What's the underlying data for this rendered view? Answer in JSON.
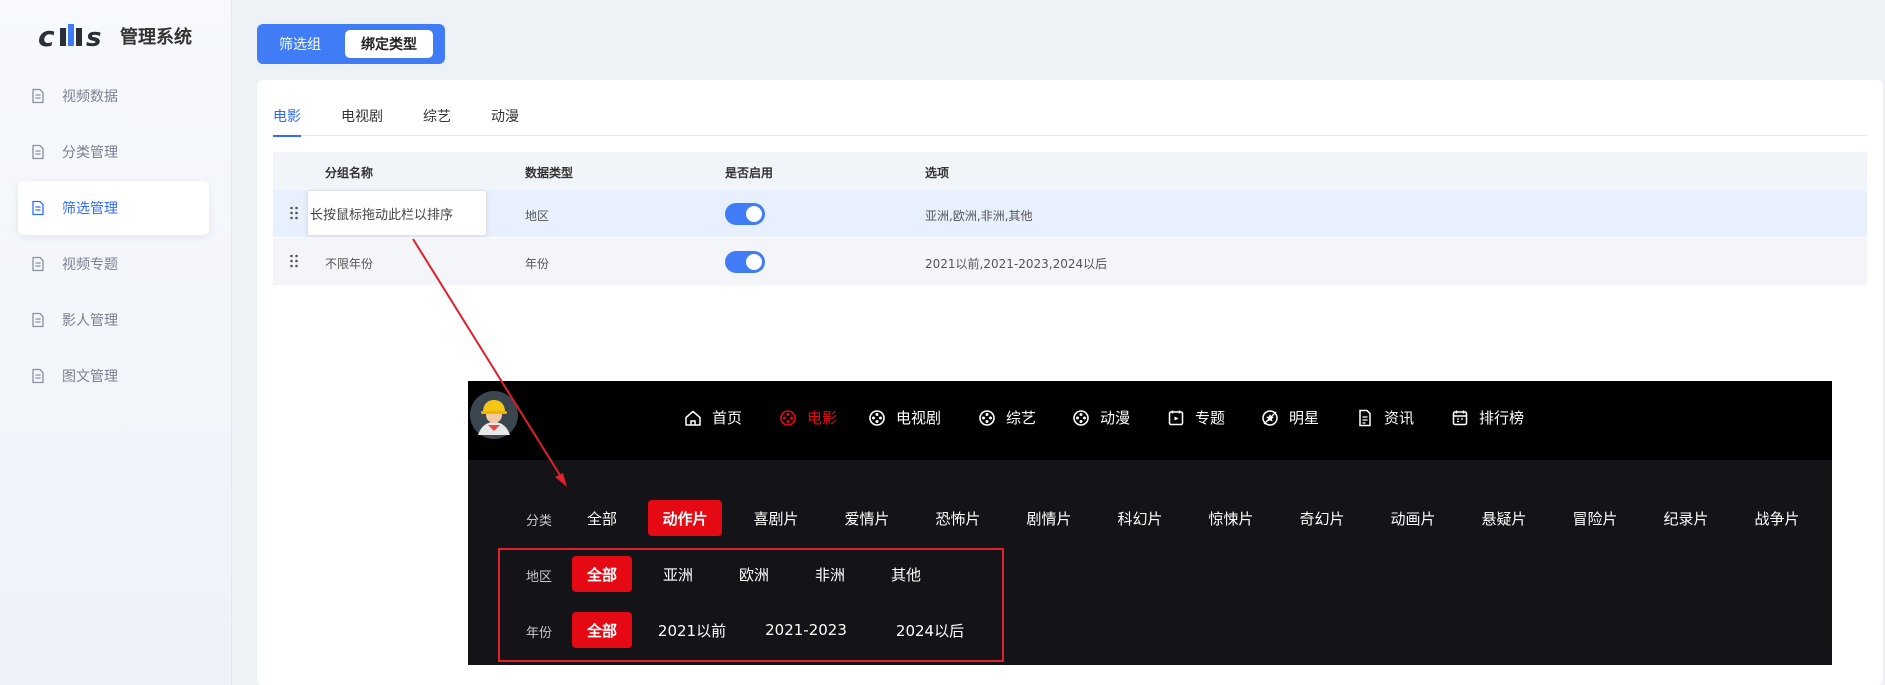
{
  "app": {
    "brand_title": "管理系统"
  },
  "sidebar": {
    "items": [
      {
        "label": "视频数据",
        "icon": "document-icon",
        "active": false
      },
      {
        "label": "分类管理",
        "icon": "document-icon",
        "active": false
      },
      {
        "label": "筛选管理",
        "icon": "document-icon",
        "active": true
      },
      {
        "label": "视频专题",
        "icon": "document-icon",
        "active": false
      },
      {
        "label": "影人管理",
        "icon": "document-icon",
        "active": false
      },
      {
        "label": "图文管理",
        "icon": "document-icon",
        "active": false
      }
    ]
  },
  "segmented": {
    "filter_group": "筛选组",
    "bind_type": "绑定类型",
    "selected": "绑定类型"
  },
  "tabs": [
    {
      "label": "电影",
      "active": true
    },
    {
      "label": "电视剧",
      "active": false
    },
    {
      "label": "综艺",
      "active": false
    },
    {
      "label": "动漫",
      "active": false
    }
  ],
  "table": {
    "headers": {
      "name": "分组名称",
      "data_type": "数据类型",
      "enabled": "是否启用",
      "options": "选项"
    },
    "rows": [
      {
        "name": "",
        "data_type": "地区",
        "enabled": true,
        "options": "亚洲,欧洲,非洲,其他"
      },
      {
        "name": "不限年份",
        "data_type": "年份",
        "enabled": true,
        "options": "2021以前,2021-2023,2024以后"
      }
    ],
    "drag_tooltip": "长按鼠标拖动此栏以排序"
  },
  "preview": {
    "nav": [
      {
        "label": "首页",
        "icon": "home-icon",
        "active": false
      },
      {
        "label": "电影",
        "icon": "film-reel-icon",
        "active": true
      },
      {
        "label": "电视剧",
        "icon": "film-reel-icon",
        "active": false
      },
      {
        "label": "综艺",
        "icon": "film-reel-icon",
        "active": false
      },
      {
        "label": "动漫",
        "icon": "film-reel-icon",
        "active": false
      },
      {
        "label": "专题",
        "icon": "calendar-play-icon",
        "active": false
      },
      {
        "label": "明星",
        "icon": "star-badge-icon",
        "active": false
      },
      {
        "label": "资讯",
        "icon": "news-document-icon",
        "active": false
      },
      {
        "label": "排行榜",
        "icon": "calendar-icon",
        "active": false
      }
    ],
    "filters": {
      "category": {
        "label": "分类",
        "options": [
          "全部",
          "动作片",
          "喜剧片",
          "爱情片",
          "恐怖片",
          "剧情片",
          "科幻片",
          "惊悚片",
          "奇幻片",
          "动画片",
          "悬疑片",
          "冒险片",
          "纪录片",
          "战争片"
        ],
        "selected": "动作片"
      },
      "region": {
        "label": "地区",
        "options": [
          "全部",
          "亚洲",
          "欧洲",
          "非洲",
          "其他"
        ],
        "selected": "全部"
      },
      "year": {
        "label": "年份",
        "options": [
          "全部",
          "2021以前",
          "2021-2023",
          "2024以后"
        ],
        "selected": "全部"
      }
    }
  },
  "colors": {
    "accent": "#3f7cf6",
    "preview_accent": "#e50914",
    "annotation": "#e0202a"
  }
}
